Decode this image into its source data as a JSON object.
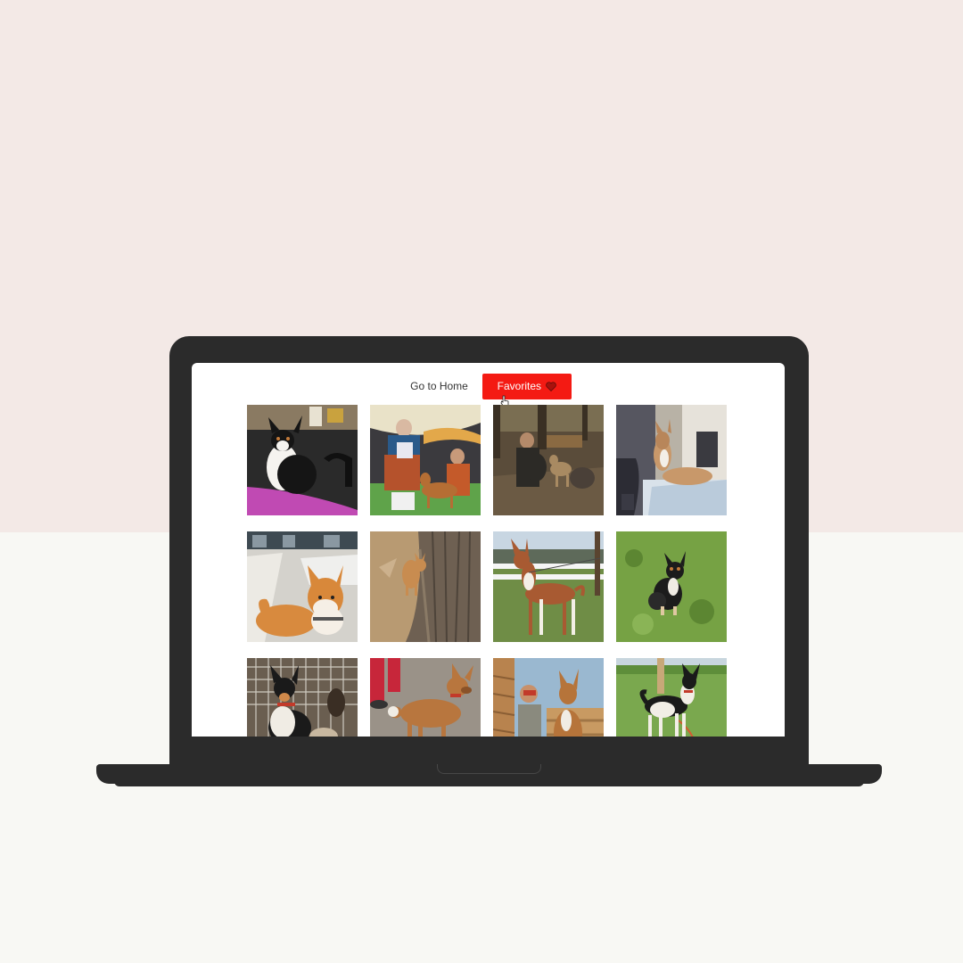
{
  "nav": {
    "home_label": "Go to Home",
    "favorites_label": "Favorites",
    "favorites_icon": "heart-icon",
    "accent_color": "#f41a13"
  },
  "gallery": {
    "subject": "Basenji dog photos",
    "tile_count": 12,
    "columns": 4
  },
  "colors": {
    "background_top": "#f3e9e6",
    "background_bottom": "#f8f8f4",
    "laptop_frame": "#2b2b2b",
    "screen": "#ffffff"
  }
}
